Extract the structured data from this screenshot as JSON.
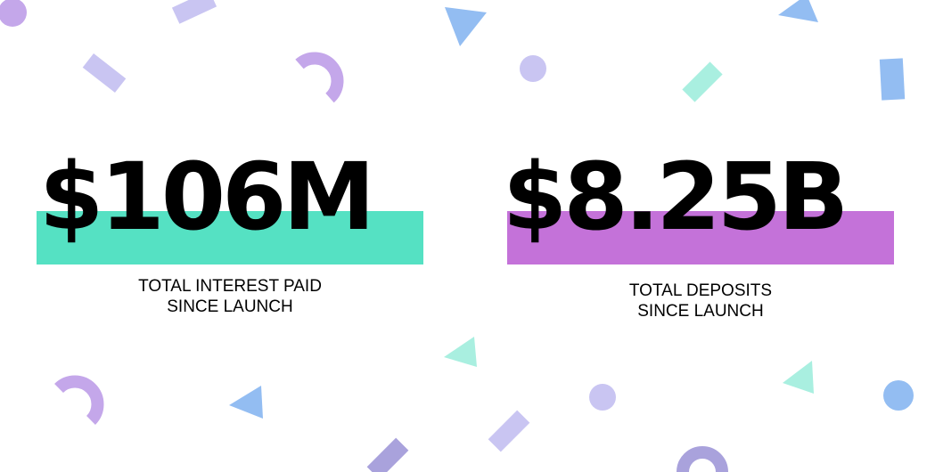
{
  "colors": {
    "teal": "#55e1c3",
    "magenta": "#c472d9",
    "lavender": "#c9c5f2",
    "purple": "#c4a7ea",
    "blue": "#93bdf2",
    "mint": "#a9efe0",
    "deep_purple": "#a9a2dc"
  },
  "stats": [
    {
      "value": "$106M",
      "caption_line1": "TOTAL INTEREST PAID",
      "caption_line2": "SINCE LAUNCH",
      "accent": "#55e1c3"
    },
    {
      "value": "$8.25B",
      "caption_line1": "TOTAL DEPOSITS",
      "caption_line2": "SINCE LAUNCH",
      "accent": "#c472d9"
    }
  ],
  "decorations": [
    "circle-shape",
    "rectangle-shape",
    "triangle-shape",
    "arc-shape"
  ]
}
